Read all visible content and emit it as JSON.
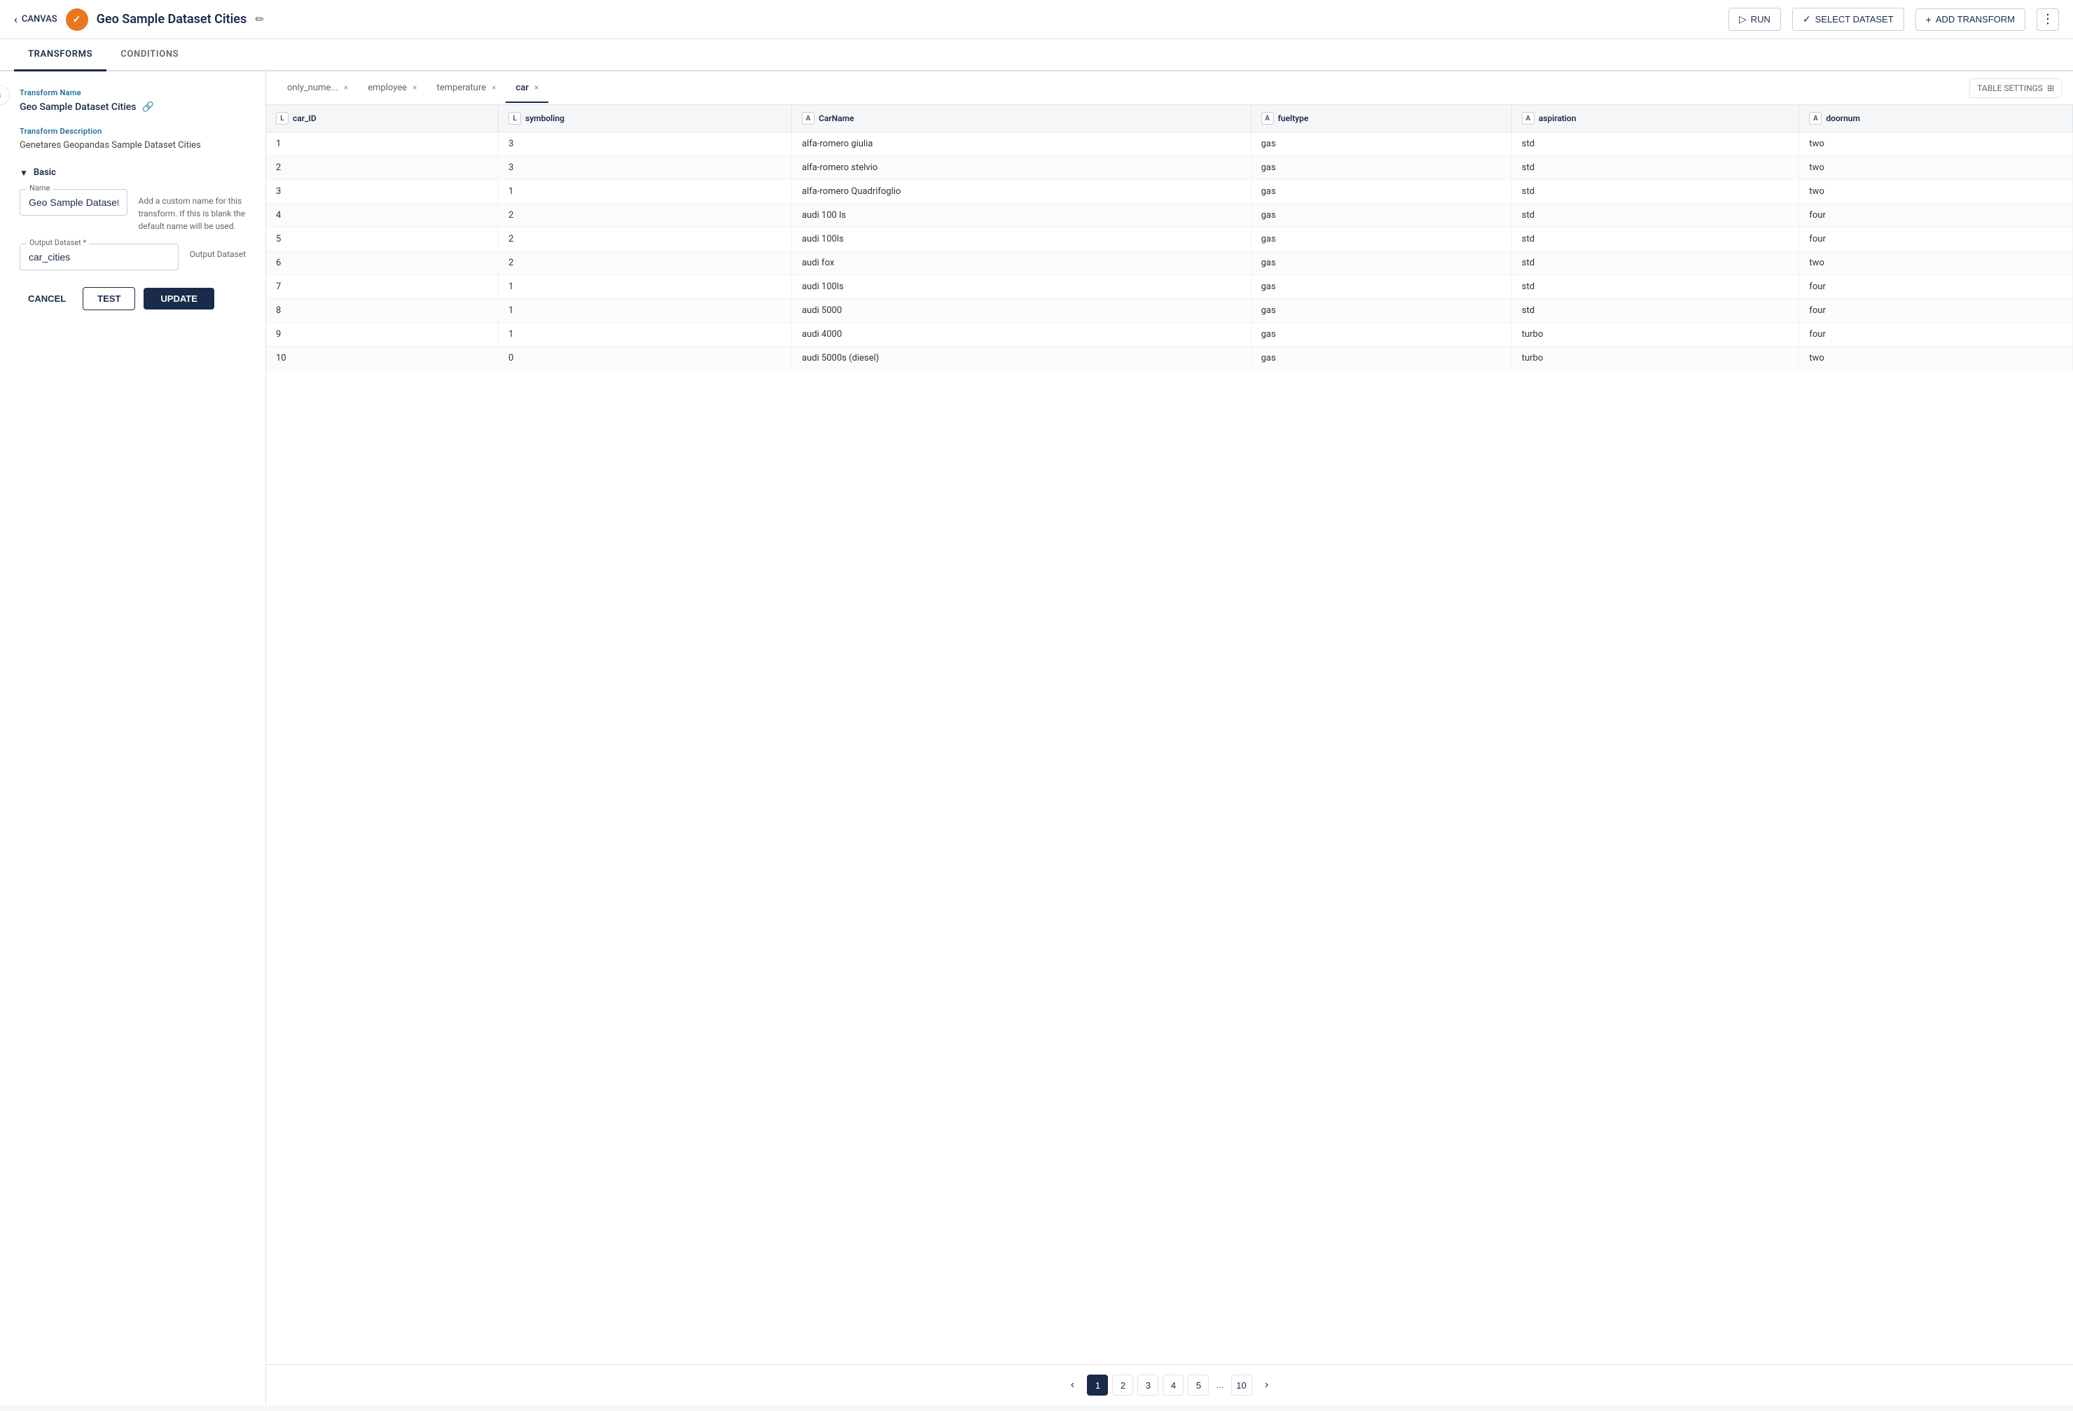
{
  "header": {
    "canvas_label": "CANVAS",
    "app_icon": "✓",
    "page_title": "Geo Sample Dataset Cities",
    "run_label": "RUN",
    "select_dataset_label": "SELECT DATASET",
    "add_transform_label": "ADD TRANSFORM"
  },
  "tabs": {
    "transforms_label": "TRANSFORMS",
    "conditions_label": "CONDITIONS"
  },
  "left_panel": {
    "transform_name_label": "Transform Name",
    "transform_name_value": "Geo Sample Dataset Cities",
    "transform_desc_label": "Transform Description",
    "transform_desc_value": "Genetares Geopandas Sample Dataset Cities",
    "basic_section_label": "Basic",
    "name_input_label": "Name",
    "name_input_value": "Geo Sample Dataset Cities",
    "name_helper_text": "Add a custom name for this transform. If this is blank the default name will be used.",
    "output_dataset_label": "Output Dataset *",
    "output_dataset_value": "car_cities",
    "output_dataset_helper": "Output Dataset",
    "cancel_label": "CANCEL",
    "test_label": "TEST",
    "update_label": "UPDATE"
  },
  "dataset_tabs": [
    {
      "id": "only_nume",
      "label": "only_nume...",
      "closable": true,
      "active": false
    },
    {
      "id": "employee",
      "label": "employee",
      "closable": true,
      "active": false
    },
    {
      "id": "temperature",
      "label": "temperature",
      "closable": true,
      "active": false
    },
    {
      "id": "car",
      "label": "car",
      "closable": true,
      "active": true
    }
  ],
  "table_settings_label": "TABLE SETTINGS",
  "columns": [
    {
      "key": "car_ID",
      "label": "car_ID",
      "type": "L"
    },
    {
      "key": "symboling",
      "label": "symboling",
      "type": "L"
    },
    {
      "key": "CarName",
      "label": "CarName",
      "type": "A"
    },
    {
      "key": "fueltype",
      "label": "fueltype",
      "type": "A"
    },
    {
      "key": "aspiration",
      "label": "aspiration",
      "type": "A"
    },
    {
      "key": "doornum",
      "label": "doornum",
      "type": "A"
    }
  ],
  "rows": [
    {
      "car_ID": "1",
      "symboling": "3",
      "CarName": "alfa-romero giulia",
      "fueltype": "gas",
      "aspiration": "std",
      "doornum": "two"
    },
    {
      "car_ID": "2",
      "symboling": "3",
      "CarName": "alfa-romero stelvio",
      "fueltype": "gas",
      "aspiration": "std",
      "doornum": "two"
    },
    {
      "car_ID": "3",
      "symboling": "1",
      "CarName": "alfa-romero Quadrifoglio",
      "fueltype": "gas",
      "aspiration": "std",
      "doornum": "two"
    },
    {
      "car_ID": "4",
      "symboling": "2",
      "CarName": "audi 100 ls",
      "fueltype": "gas",
      "aspiration": "std",
      "doornum": "four"
    },
    {
      "car_ID": "5",
      "symboling": "2",
      "CarName": "audi 100ls",
      "fueltype": "gas",
      "aspiration": "std",
      "doornum": "four"
    },
    {
      "car_ID": "6",
      "symboling": "2",
      "CarName": "audi fox",
      "fueltype": "gas",
      "aspiration": "std",
      "doornum": "two"
    },
    {
      "car_ID": "7",
      "symboling": "1",
      "CarName": "audi 100ls",
      "fueltype": "gas",
      "aspiration": "std",
      "doornum": "four"
    },
    {
      "car_ID": "8",
      "symboling": "1",
      "CarName": "audi 5000",
      "fueltype": "gas",
      "aspiration": "std",
      "doornum": "four"
    },
    {
      "car_ID": "9",
      "symboling": "1",
      "CarName": "audi 4000",
      "fueltype": "gas",
      "aspiration": "turbo",
      "doornum": "four"
    },
    {
      "car_ID": "10",
      "symboling": "0",
      "CarName": "audi 5000s (diesel)",
      "fueltype": "gas",
      "aspiration": "turbo",
      "doornum": "two"
    }
  ],
  "pagination": {
    "prev_label": "‹",
    "next_label": "›",
    "pages": [
      "1",
      "2",
      "3",
      "4",
      "5",
      "...",
      "10"
    ],
    "active_page": "1"
  }
}
